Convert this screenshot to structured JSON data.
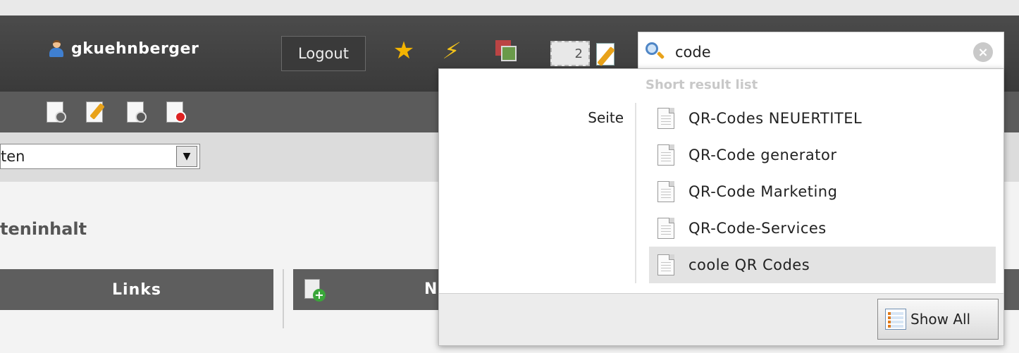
{
  "header": {
    "username": "gkuehnberger",
    "logout_label": "Logout",
    "counter": "2",
    "icons": [
      "user-icon",
      "star-icon",
      "flash-icon",
      "stack-icon",
      "counter-badge",
      "edit-document-icon"
    ]
  },
  "search": {
    "value": "code",
    "placeholder": ""
  },
  "page": {
    "select_value": "ten",
    "section_title": "teninhalt",
    "columns": {
      "left": "Links",
      "right": "N"
    }
  },
  "dropdown": {
    "heading": "Short result list",
    "category": "Seite",
    "items": [
      {
        "label": "QR-Codes NEUERTITEL"
      },
      {
        "label": "QR-Code generator"
      },
      {
        "label": "QR-Code Marketing"
      },
      {
        "label": "QR-Code-Services"
      },
      {
        "label": "coole QR Codes",
        "active": true
      }
    ],
    "show_all_label": "Show All"
  },
  "colors": {
    "topbar": "#3f3f3f",
    "toolbar": "#5b5b5b",
    "selectbar": "#dcdcdc",
    "column_header": "#5e5e5e",
    "active_item": "#e3e3e3",
    "heading_muted": "#c8c8c8"
  }
}
